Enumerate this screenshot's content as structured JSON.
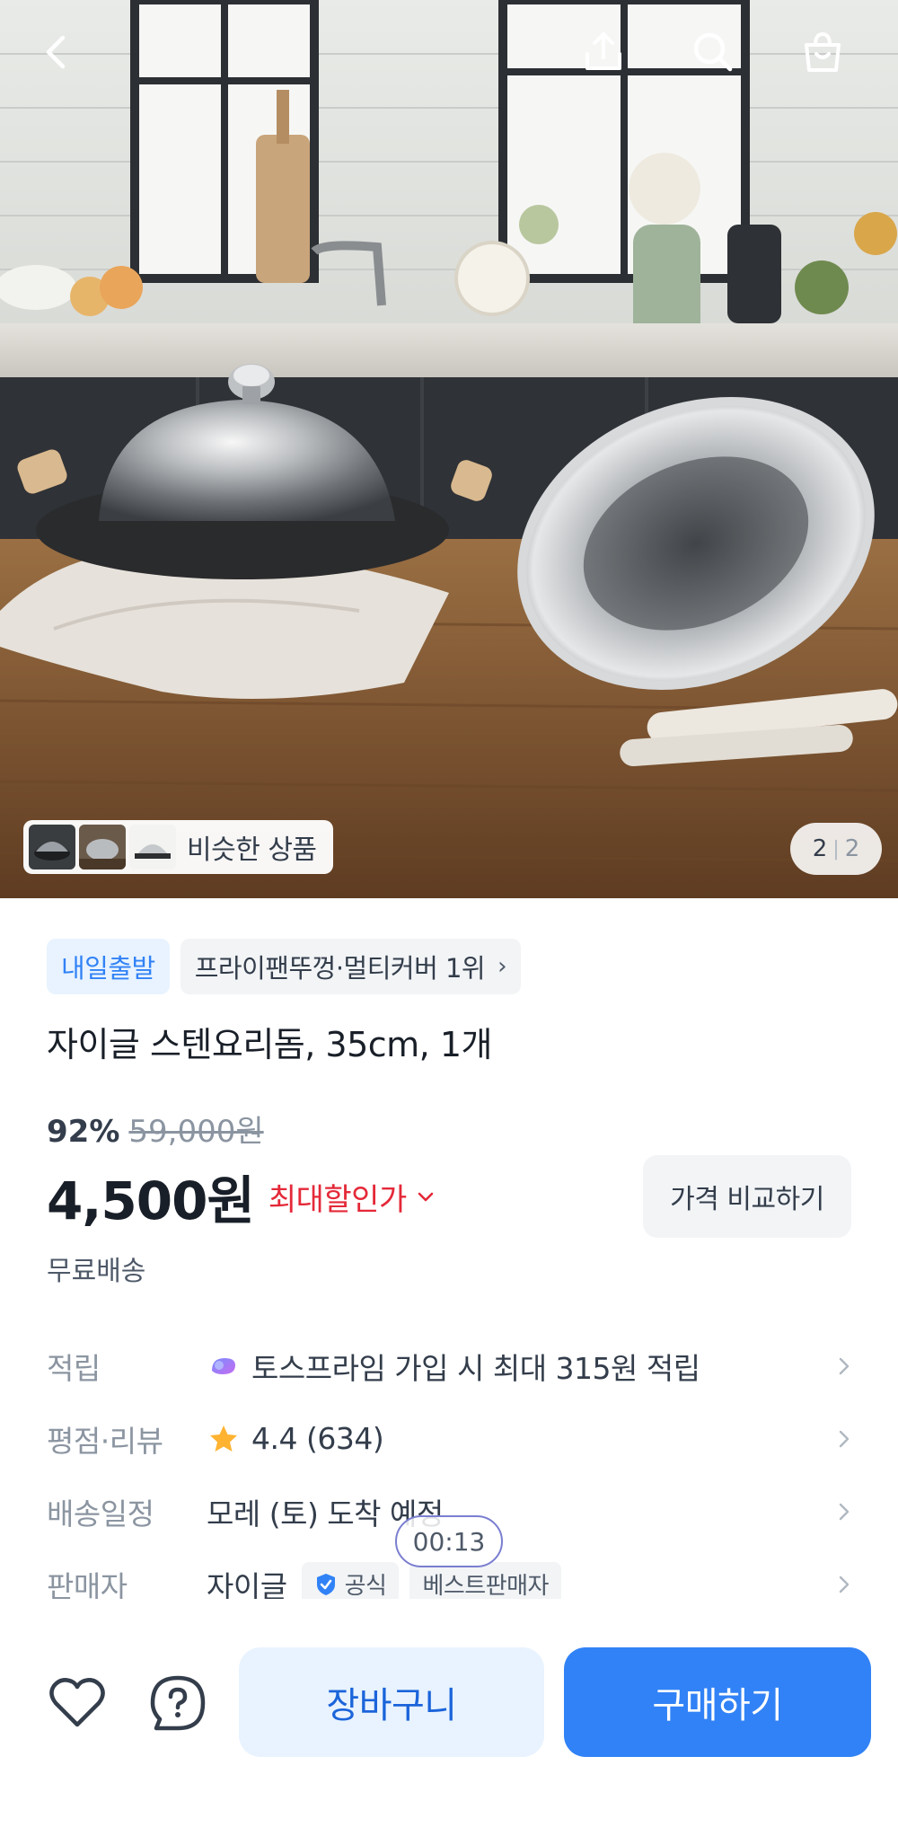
{
  "header": {
    "back_icon": "chevron-left-icon",
    "share_icon": "share-icon",
    "search_icon": "search-icon",
    "bag_icon": "shopping-bag-icon"
  },
  "gallery": {
    "similar_label": "비슷한 상품",
    "page_current": "2",
    "page_separator": "|",
    "page_total": "2"
  },
  "tags": {
    "delivery_tag": "내일출발",
    "ranking_tag": "프라이팬뚜껑·멀티커버 1위"
  },
  "product": {
    "title": "자이글 스텐요리돔, 35cm, 1개",
    "discount_percent": "92%",
    "original_price": "59,000원",
    "price": "4,500원",
    "max_discount_label": "최대할인가",
    "compare_button": "가격 비교하기",
    "shipping": "무료배송"
  },
  "details": {
    "points_label": "적립",
    "points_value": "토스프라임 가입 시 최대 315원 적립",
    "rating_label": "평점·리뷰",
    "rating_value": "4.4 (634)",
    "delivery_label": "배송일정",
    "delivery_value": "모레 (토) 도착 예정",
    "seller_label": "판매자",
    "seller_value": "자이글",
    "official_badge": "공식",
    "best_badge": "베스트판매자"
  },
  "timer": "00:13",
  "bottom_bar": {
    "cart_button": "장바구니",
    "buy_button": "구매하기"
  },
  "colors": {
    "primary": "#3182f6",
    "primary_light": "#e8f3ff",
    "discount_red": "#e42939",
    "star": "#ffb331"
  }
}
